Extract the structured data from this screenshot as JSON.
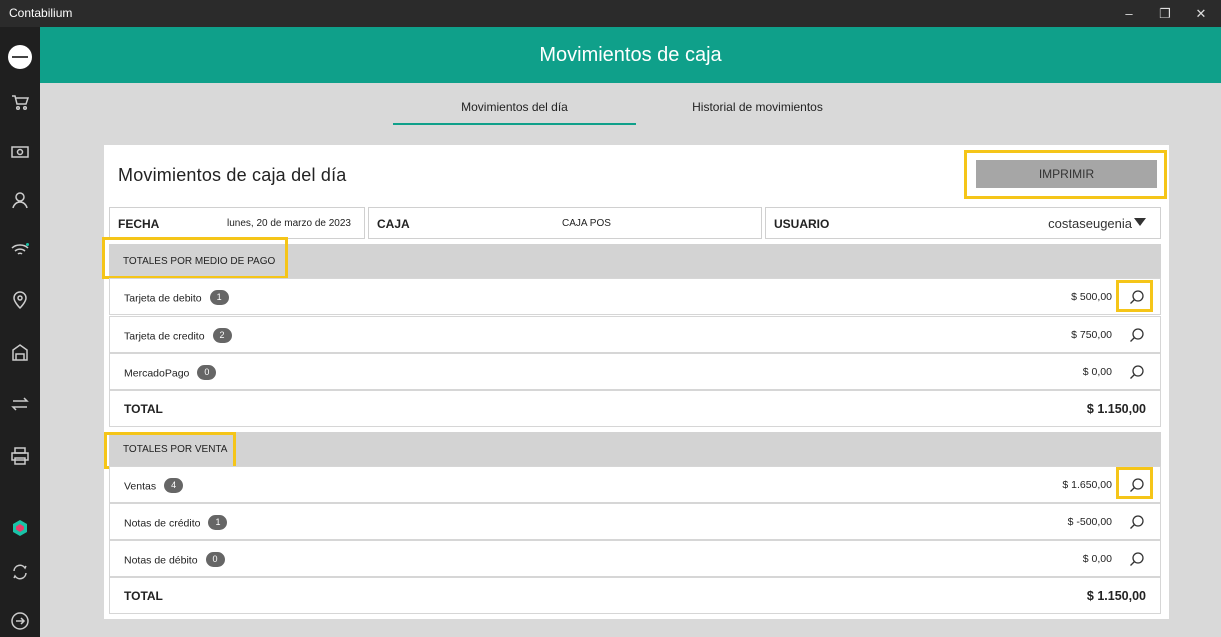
{
  "window": {
    "title": "Contabilium"
  },
  "header": {
    "title": "Movimientos de caja"
  },
  "tabs": [
    {
      "label": "Movimientos del día"
    },
    {
      "label": "Historial de movimientos"
    }
  ],
  "card": {
    "title": "Movimientos de caja del día",
    "print_label": "IMPRIMIR",
    "fields": {
      "fecha_label": "FECHA",
      "fecha_value": "lunes, 20 de marzo de 2023",
      "caja_label": "CAJA",
      "caja_value": "CAJA POS",
      "usuario_label": "USUARIO",
      "usuario_value": "costaseugenia"
    }
  },
  "medio_pago": {
    "title": "TOTALES POR MEDIO DE PAGO",
    "rows": [
      {
        "label": "Tarjeta de debito",
        "count": "1",
        "amount": "$ 500,00"
      },
      {
        "label": "Tarjeta de credito",
        "count": "2",
        "amount": "$ 750,00"
      },
      {
        "label": "MercadoPago",
        "count": "0",
        "amount": "$ 0,00"
      }
    ],
    "total_label": "TOTAL",
    "total_amount": "$ 1.150,00"
  },
  "venta": {
    "title": "TOTALES POR VENTA",
    "rows": [
      {
        "label": "Ventas",
        "count": "4",
        "amount": "$ 1.650,00"
      },
      {
        "label": "Notas de crédito",
        "count": "1",
        "amount": "$ -500,00"
      },
      {
        "label": "Notas de débito",
        "count": "0",
        "amount": "$ 0,00"
      }
    ],
    "total_label": "TOTAL",
    "total_amount": "$ 1.150,00"
  },
  "colors": {
    "brand": "#0fa08a",
    "highlight": "#f5c518",
    "rail": "#1f1f1f"
  },
  "icons": [
    "avatar",
    "cart-icon",
    "cash-icon",
    "user-icon",
    "wifi-icon",
    "location-icon",
    "store-icon",
    "transfer-icon",
    "printer-icon",
    "brand-logo-icon",
    "sync-icon",
    "logout-icon",
    "search-icon",
    "dropdown-arrow-icon"
  ]
}
